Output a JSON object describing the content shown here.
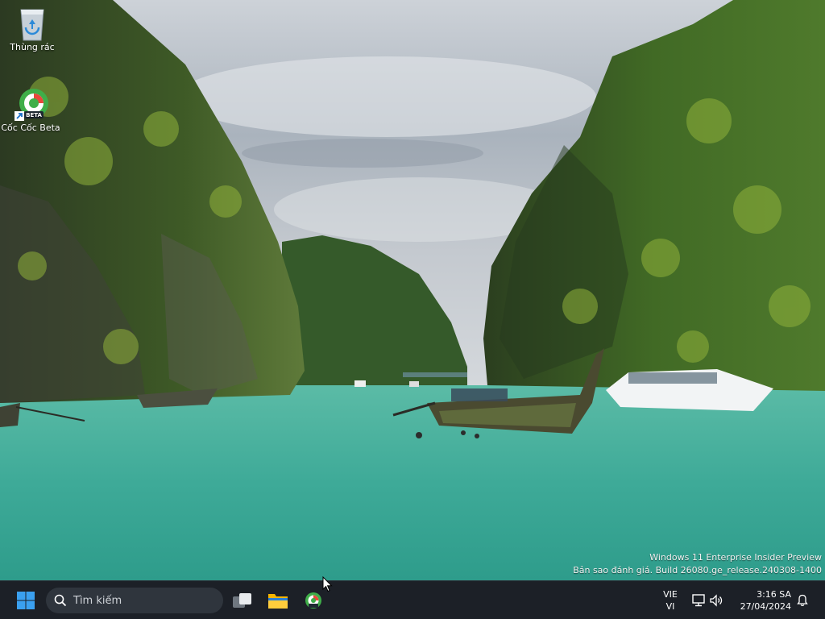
{
  "desktop": {
    "icons": [
      {
        "label": "Thùng rác",
        "icon": "recycle-bin-icon"
      },
      {
        "label": "Cốc Cốc Beta",
        "icon": "coccoc-beta-icon",
        "badge": "BETA"
      }
    ],
    "watermark": {
      "line1": "Windows 11 Enterprise Insider Preview",
      "line2": "Bản sao đánh giá. Build 26080.ge_release.240308-1400"
    }
  },
  "taskbar": {
    "search_placeholder": "Tìm kiếm",
    "pinned": [
      "start-icon",
      "task-view-icon",
      "file-explorer-icon",
      "coccoc-beta-icon"
    ],
    "language": {
      "line1": "VIE",
      "line2": "VI"
    },
    "clock": {
      "time": "3:16 SA",
      "date": "27/04/2024"
    },
    "colors": {
      "background": "#1c2027",
      "accent": "#0078d4"
    }
  }
}
